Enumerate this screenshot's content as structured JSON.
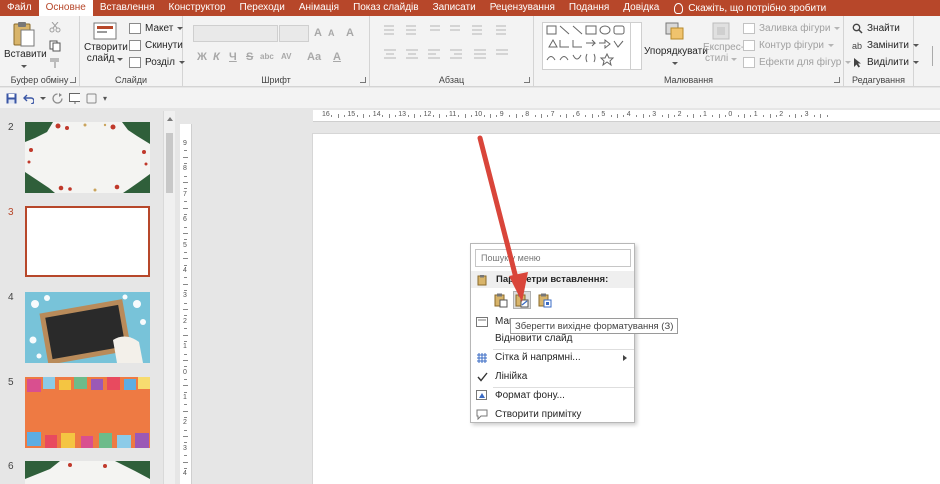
{
  "menu": {
    "tabs": [
      "Файл",
      "Основне",
      "Вставлення",
      "Конструктор",
      "Переходи",
      "Анімація",
      "Показ слайдів",
      "Записати",
      "Рецензування",
      "Подання",
      "Довідка"
    ],
    "active_tab": "Основне",
    "tell_me": "Скажіть, що потрібно зробити"
  },
  "ribbon": {
    "clipboard": {
      "paste": "Вставити",
      "label": "Буфер обміну"
    },
    "slides": {
      "new_slide_line1": "Створити",
      "new_slide_line2": "слайд",
      "layout": "Макет",
      "reset": "Скинути",
      "section": "Розділ",
      "label": "Слайди"
    },
    "font": {
      "label": "Шрифт",
      "bold": "Ж",
      "italic": "К",
      "underline": "Ч",
      "strike": "S",
      "shadow": "abc",
      "spacing": "AV",
      "case": "Aa",
      "color": "A"
    },
    "paragraph": {
      "label": "Абзац"
    },
    "drawing": {
      "arrange": "Упорядкувати",
      "quick_styles_line1": "Експрес-",
      "quick_styles_line2": "стилі",
      "shape_fill": "Заливка фігури",
      "shape_outline": "Контур фігури",
      "shape_effects": "Ефекти для фігур",
      "label": "Малювання"
    },
    "editing": {
      "find": "Знайти",
      "replace": "Замінити",
      "select": "Виділити",
      "label": "Редагування"
    }
  },
  "thumbnails": [
    {
      "num": "2",
      "kind": "christmas-frame",
      "active": false
    },
    {
      "num": "3",
      "kind": "blank",
      "active": true
    },
    {
      "num": "4",
      "kind": "chalkboard",
      "active": false
    },
    {
      "num": "5",
      "kind": "gifts-orange",
      "active": false
    },
    {
      "num": "6",
      "kind": "christmas-branches",
      "active": false
    }
  ],
  "ruler": {
    "horizontal_labels": [
      "16",
      "15",
      "14",
      "13",
      "12",
      "11",
      "10",
      "9",
      "8",
      "7",
      "6",
      "5",
      "4",
      "3",
      "2",
      "1",
      "0",
      "1",
      "2",
      "3"
    ],
    "vertical_labels": [
      "9",
      "8",
      "7",
      "6",
      "5",
      "4",
      "3",
      "2",
      "1",
      "0",
      "1",
      "2",
      "3",
      "4",
      "5",
      "6",
      "7",
      "8",
      "9"
    ]
  },
  "context_menu": {
    "search_placeholder": "Пошук у меню",
    "paste_header": "Параметри вставлення:",
    "items": {
      "layout": "Макет",
      "reset_slide": "Відновити слайд",
      "grid": "Сітка й напрямні...",
      "ruler": "Лінійка",
      "format_bg": "Формат фону...",
      "new_comment": "Створити примітку"
    }
  },
  "tooltip": "Зберегти вихідне форматування (З)",
  "colors": {
    "accent": "#b7472a",
    "arrow": "#d9453a"
  }
}
